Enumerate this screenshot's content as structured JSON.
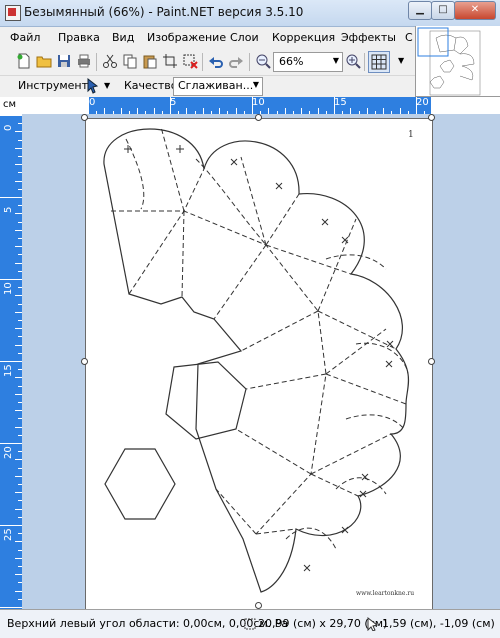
{
  "window": {
    "title": "Безымянный (66%) - Paint.NET версия 3.5.10"
  },
  "menu": [
    "Файл",
    "Правка",
    "Вид",
    "Изображение",
    "Слои",
    "Коррекция",
    "Эффекты",
    "С"
  ],
  "toolbar": {
    "zoom_value": "66%",
    "tool_label": "Инструмент:",
    "quality_label": "Качество:",
    "quality_value": "Сглаживан..."
  },
  "rulers": {
    "unit": "см",
    "h_labels": [
      "0",
      "5",
      "10",
      "15",
      "20"
    ],
    "v_labels": [
      "0",
      "5",
      "10",
      "15",
      "20",
      "25"
    ]
  },
  "document": {
    "page_number": "1",
    "footer_url": "www.leartonkne.ru"
  },
  "status": {
    "selection_origin": "Верхний левый угол области: 0,00см, 0,00см. Ра",
    "image_size": "20,99 (см) x 29,70 (см)",
    "cursor_pos": "1,59 (см), -1,09 (см)"
  },
  "colors": {
    "ruler_active": "#2e7fe0",
    "workspace": "#bcd0e8"
  }
}
